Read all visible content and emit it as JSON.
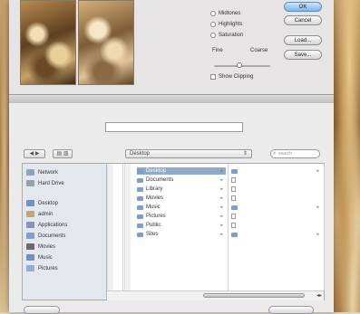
{
  "dialog": {
    "sheet_title": "",
    "sheet_title_left": "",
    "sheet_subtitle": ""
  },
  "preview": {
    "original_label": "",
    "modified_label": ""
  },
  "options": [
    {
      "label": "Midtones"
    },
    {
      "label": "Highlights"
    },
    {
      "label": "Saturation"
    }
  ],
  "fine_label": "Fine",
  "coarse_label": "Coarse",
  "show_clipping_label": "Show Clipping",
  "buttons": {
    "ok": "OK",
    "cancel": "Cancel",
    "load": "Load...",
    "save": "Save..."
  },
  "save_as": {
    "label": "",
    "value": ""
  },
  "location": "Desktop",
  "search": {
    "placeholder": "search"
  },
  "sidebar": {
    "devices": [
      {
        "label": "Network",
        "color": "#8fa3bf"
      },
      {
        "label": "Hard Drive",
        "color": "#9aa0a8"
      }
    ],
    "places": [
      {
        "label": "Desktop",
        "color": "#6e90c9"
      },
      {
        "label": "admin",
        "color": "#c9a46e"
      },
      {
        "label": "Applications",
        "color": "#8a8fc4"
      },
      {
        "label": "Documents",
        "color": "#7f9fd0"
      },
      {
        "label": "Movies",
        "color": "#6a6a6a"
      },
      {
        "label": "Music",
        "color": "#6f8fc9"
      },
      {
        "label": "Pictures",
        "color": "#8fb0d4"
      }
    ]
  },
  "column2": [
    {
      "label": "Desktop",
      "selected": true
    },
    {
      "label": "Documents"
    },
    {
      "label": "Library"
    },
    {
      "label": "Movies"
    },
    {
      "label": "Music"
    },
    {
      "label": "Pictures"
    },
    {
      "label": "Public"
    },
    {
      "label": "Sites"
    }
  ],
  "column3": [
    {
      "label": "",
      "folder": true
    },
    {
      "label": ""
    },
    {
      "label": ""
    },
    {
      "label": ""
    },
    {
      "label": "",
      "folder": true
    },
    {
      "label": ""
    },
    {
      "label": ""
    },
    {
      "label": "",
      "folder": true
    }
  ]
}
